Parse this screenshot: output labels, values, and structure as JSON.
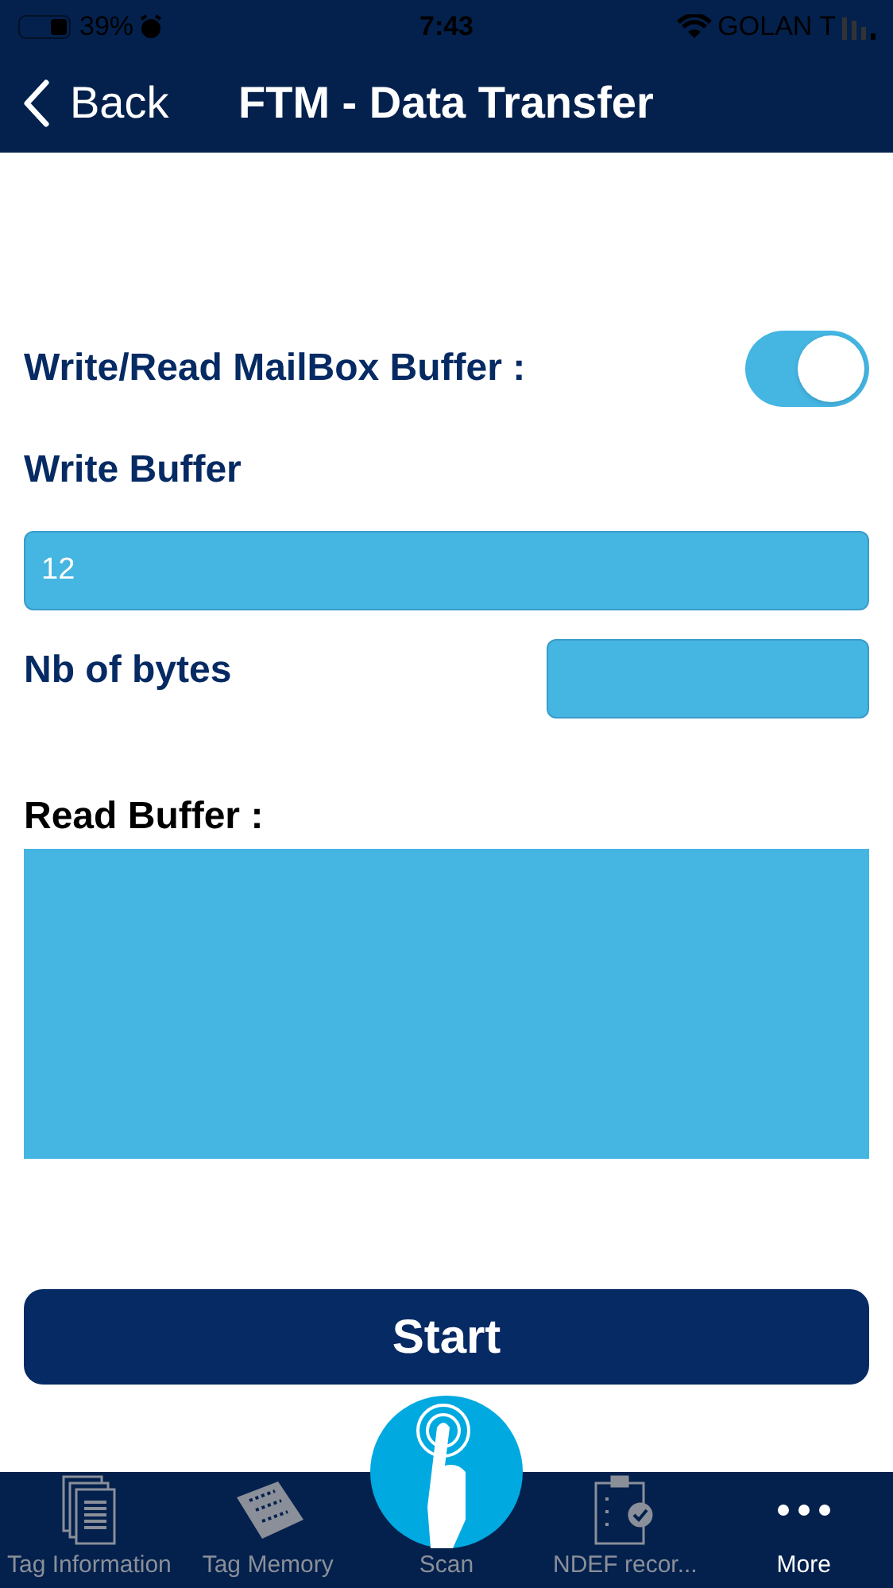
{
  "status_bar": {
    "battery": "39%",
    "time": "7:43",
    "carrier": "GOLAN T"
  },
  "nav": {
    "back": "Back",
    "title": "FTM - Data Transfer"
  },
  "mailbox": {
    "label": "Write/Read MailBox Buffer :",
    "on": true
  },
  "write_buffer": {
    "label": "Write Buffer",
    "value": "12"
  },
  "nb_bytes": {
    "label": "Nb of bytes"
  },
  "read_buffer": {
    "label": "Read Buffer :"
  },
  "start_button": "Start",
  "tabs": [
    {
      "kind": "docs",
      "label": "Tag Information",
      "selected": false
    },
    {
      "kind": "chip",
      "label": "Tag Memory",
      "selected": false
    },
    {
      "kind": "scan",
      "label": "Scan",
      "selected": false
    },
    {
      "kind": "clipboard",
      "label": "NDEF recor...",
      "selected": false
    },
    {
      "kind": "more",
      "label": "More",
      "selected": true
    }
  ]
}
